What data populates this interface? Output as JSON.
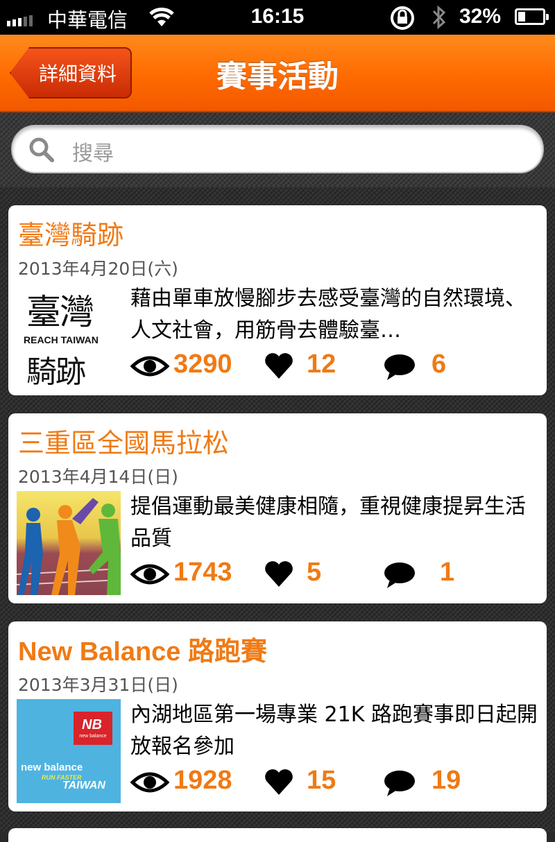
{
  "status_bar": {
    "carrier": "中華電信",
    "time": "16:15",
    "battery": "32%"
  },
  "nav": {
    "back_label": "詳細資料",
    "title": "賽事活動"
  },
  "search": {
    "placeholder": "搜尋"
  },
  "events": [
    {
      "title": "臺灣騎跡",
      "date": "2013年4月20日(六)",
      "description": "藉由單車放慢腳步去感受臺灣的自然環境、人文社會，用筋骨去體驗臺…",
      "thumb_line1": "臺灣",
      "thumb_line2": "REACH TAIWAN",
      "thumb_line3": "騎跡",
      "views": "3290",
      "likes": "12",
      "comments": "6"
    },
    {
      "title": "三重區全國馬拉松",
      "date": "2013年4月14日(日)",
      "description": "提倡運動最美健康相隨，重視健康提昇生活品質",
      "views": "1743",
      "likes": "5",
      "comments": "1"
    },
    {
      "title": "New Balance 路跑賽",
      "date": "2013年3月31日(日)",
      "description": "內湖地區第一場專業 21K 路跑賽事即日起開放報名參加",
      "thumb_line1": "new balance",
      "thumb_line2": "new balance",
      "thumb_line3": "RUN FASTER",
      "thumb_line4": "TAIWAN",
      "views": "1928",
      "likes": "15",
      "comments": "19"
    }
  ]
}
